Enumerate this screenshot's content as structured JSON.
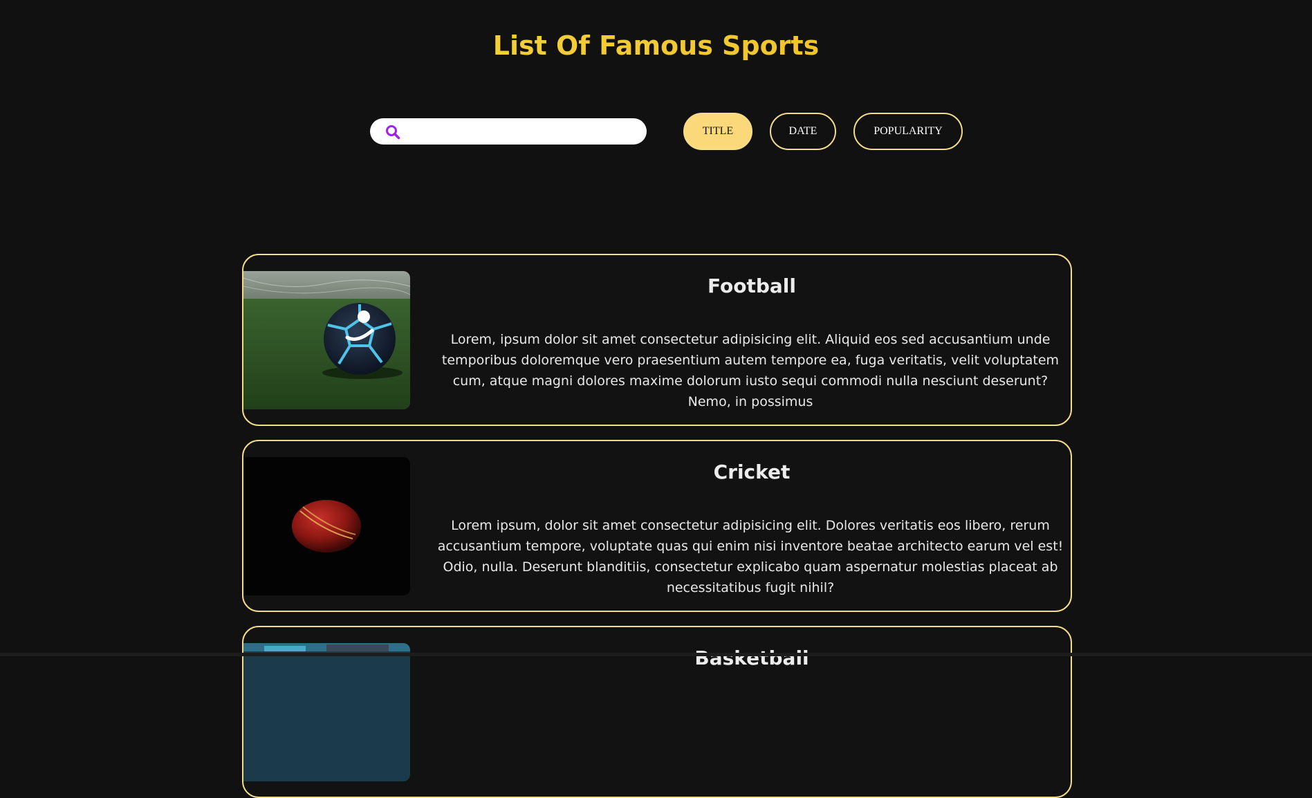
{
  "header": {
    "title": "List Of Famous Sports"
  },
  "search": {
    "placeholder": "",
    "value": "",
    "icon": "search-icon"
  },
  "sort": {
    "buttons": [
      {
        "label": "TITLE",
        "active": true
      },
      {
        "label": "DATE",
        "active": false
      },
      {
        "label": "POPULARITY",
        "active": false
      }
    ]
  },
  "colors": {
    "background": "#111111",
    "accent": "#fbd97a",
    "border": "#f3dc8a",
    "search_icon": "#a020f0"
  },
  "sports": [
    {
      "title": "Football",
      "image": "football-image",
      "description": "Lorem, ipsum dolor sit amet consectetur adipisicing elit. Aliquid eos sed accusantium unde temporibus doloremque vero praesentium autem tempore ea, fuga veritatis, velit voluptatem cum, atque magni dolores maxime dolorum iusto sequi commodi nulla nesciunt deserunt? Nemo, in possimus"
    },
    {
      "title": "Cricket",
      "image": "cricket-ball-image",
      "description": "Lorem ipsum, dolor sit amet consectetur adipisicing elit. Dolores veritatis eos libero, rerum accusantium tempore, voluptate quas qui enim nisi inventore beatae architecto earum vel est! Odio, nulla. Deserunt blanditiis, consectetur explicabo quam aspernatur molestias placeat ab necessitatibus fugit nihil?"
    },
    {
      "title": "Basketball",
      "image": "basketball-image",
      "description": ""
    }
  ]
}
